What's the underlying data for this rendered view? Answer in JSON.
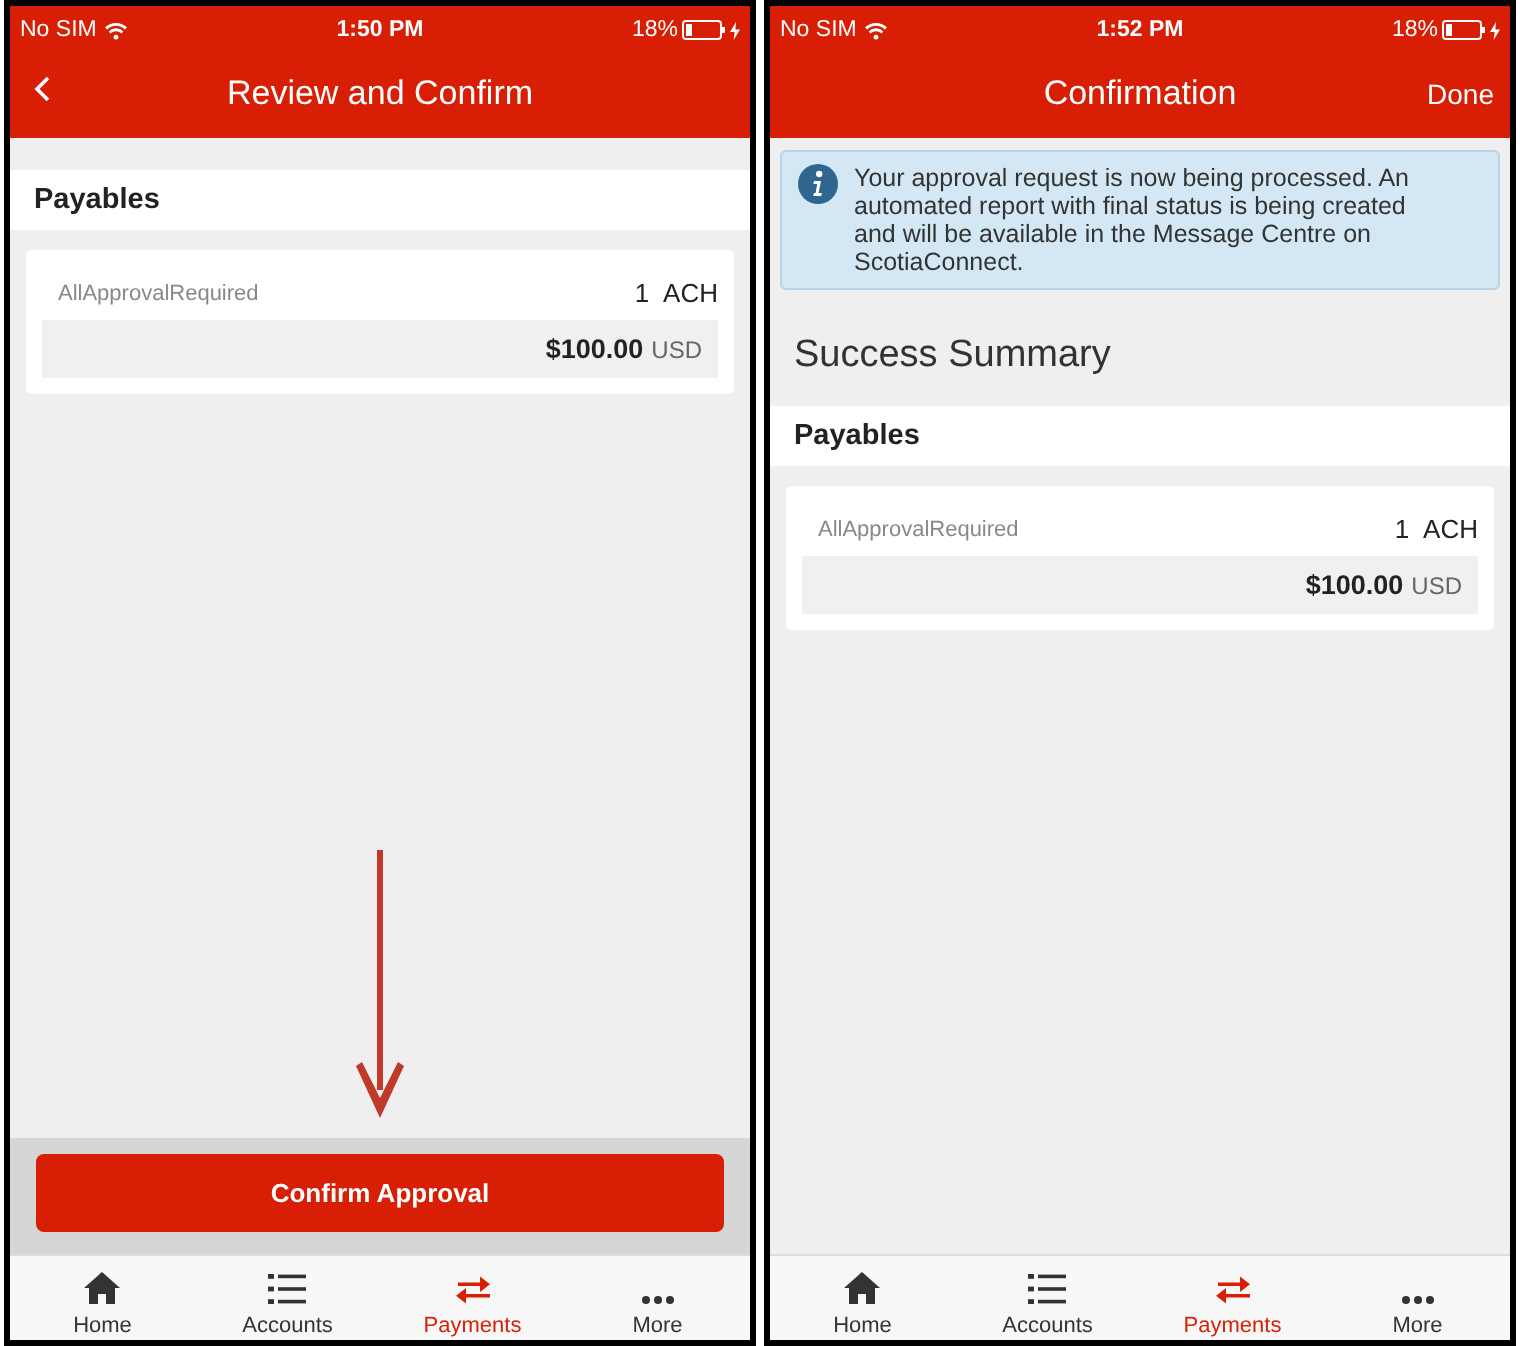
{
  "screens": [
    {
      "status_bar": {
        "carrier": "No SIM",
        "time": "1:50 PM",
        "battery": "18%"
      },
      "nav": {
        "back": true,
        "title": "Review and Confirm"
      },
      "section": {
        "title": "Payables",
        "items": [
          {
            "name": "AllApprovalRequired",
            "count": "1",
            "type": "ACH",
            "amount": "$100.00",
            "currency": "USD"
          }
        ]
      },
      "pointer_arrow": true,
      "button": "Confirm Approval",
      "tabs": [
        {
          "label": "Home",
          "selected": false
        },
        {
          "label": "Accounts",
          "selected": false
        },
        {
          "label": "Payments",
          "selected": true
        },
        {
          "label": "More",
          "selected": false
        }
      ]
    },
    {
      "status_bar": {
        "carrier": "No SIM",
        "time": "1:52 PM",
        "battery": "18%"
      },
      "nav": {
        "back": false,
        "title": "Confirmation",
        "action": "Done"
      },
      "notice": "Your approval request is now being processed. An automated report with final status is being created and will be available in the Message Centre on ScotiaConnect.",
      "heading": "Success Summary",
      "section": {
        "title": "Payables",
        "items": [
          {
            "name": "AllApprovalRequired",
            "count": "1",
            "type": "ACH",
            "amount": "$100.00",
            "currency": "USD"
          }
        ]
      },
      "pointer_arrow": false,
      "tabs": [
        {
          "label": "Home",
          "selected": false
        },
        {
          "label": "Accounts",
          "selected": false
        },
        {
          "label": "Payments",
          "selected": true
        },
        {
          "label": "More",
          "selected": false
        }
      ]
    }
  ]
}
